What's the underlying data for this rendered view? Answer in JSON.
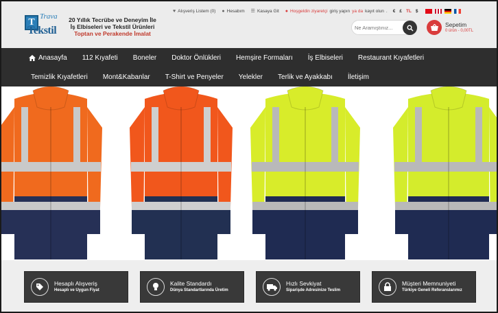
{
  "brand": {
    "logo_word1": "Trava",
    "logo_word2": "Tekstil",
    "logo_letter": "T",
    "tagline_line1": "20 Yıllık Tecrübe ve Deneyim İle",
    "tagline_line2": "İş Elbiseleri ve Tekstil Ürünleri",
    "tagline_line3": "Toptan ve Perakende İmalat",
    "primary_color": "#2b7fb8",
    "accent_color": "#d93c3c"
  },
  "topbar": {
    "wishlist": "Alışveriş Listem (0)",
    "account": "Hesabım",
    "checkout": "Kasaya Git",
    "welcome": "Hoşgeldin ziyaretçi",
    "login": "giriş yapın",
    "or": "ya da",
    "register": "kayıt olun",
    "currencies": [
      "€",
      "£",
      "TL",
      "$"
    ]
  },
  "search": {
    "placeholder": "Ne Aramıştınız..."
  },
  "cart": {
    "title": "Sepetim",
    "summary": "0 ürün - 0,00TL"
  },
  "nav": {
    "row1": [
      "Anasayfa",
      "112 Kıyafeti",
      "Boneler",
      "Doktor Önlükleri",
      "Hemşire Formaları",
      "İş Elbiseleri",
      "Restaurant Kıyafetleri"
    ],
    "row2": [
      "Temizlik Kıyafetleri",
      "Mont&Kabanlar",
      "T-Shirt ve Penyeler",
      "Yelekler",
      "Terlik ve Ayakkabı",
      "İletişim"
    ]
  },
  "hero": {
    "jackets": [
      {
        "body": "#f06a1e",
        "bottom": "#263056",
        "stripe": "#c9c9c9"
      },
      {
        "body": "#f1571c",
        "bottom": "#223052",
        "stripe": "#cfcfcf"
      },
      {
        "body": "#d8ec2a",
        "bottom": "#1f2b52",
        "stripe": "#b9b9b9"
      },
      {
        "body": "#d4ec2c",
        "bottom": "#1f2b52",
        "stripe": "#b9b9b9"
      }
    ]
  },
  "features": [
    {
      "title": "Hesaplı Alışveriş",
      "subtitle": "Hesaplı ve Uygun Fiyat",
      "icon": "price-tag-icon"
    },
    {
      "title": "Kalite Standardı",
      "subtitle": "Dünya Standartlarında Üretim",
      "icon": "lightbulb-icon"
    },
    {
      "title": "Hızlı Sevkiyat",
      "subtitle": "Siparişde Adresinize Teslim",
      "icon": "truck-icon"
    },
    {
      "title": "Müşteri Memnuniyeti",
      "subtitle": "Türkiye Geneli Referanslarımız",
      "icon": "lock-icon"
    }
  ]
}
